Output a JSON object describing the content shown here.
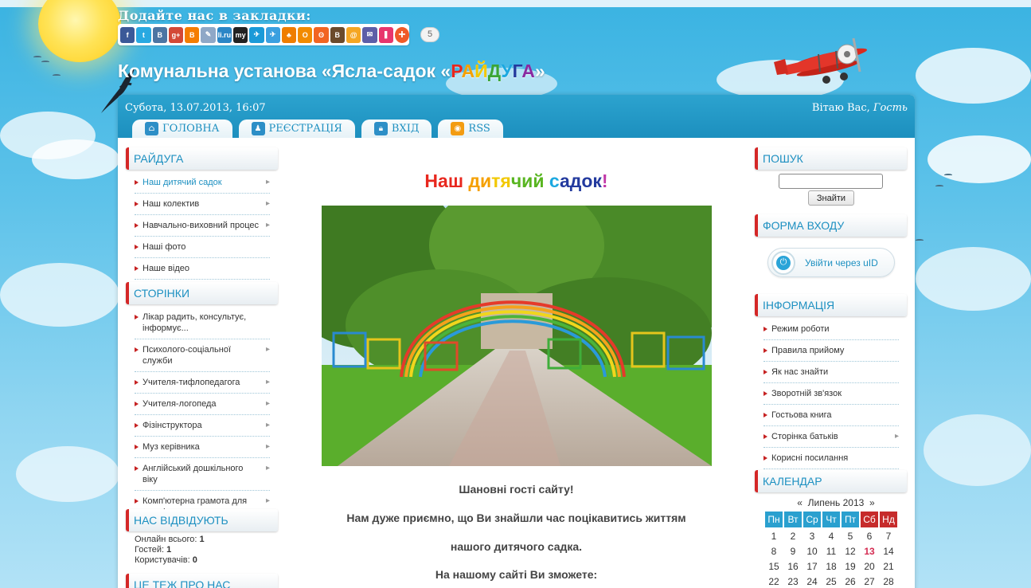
{
  "header": {
    "bookmark_title": "Додайте нас в закладки:",
    "share_count": "5",
    "site_title_prefix": "Комунальна установа «Ясла-садок «",
    "site_title_rainbow": [
      "Р",
      "А",
      "Й",
      "Д",
      "У",
      "Г",
      "А"
    ],
    "site_title_suffix": "»"
  },
  "share_buttons": [
    {
      "name": "facebook",
      "glyph": "f",
      "color": "#3b5998"
    },
    {
      "name": "twitter",
      "glyph": "t",
      "color": "#29a9e1"
    },
    {
      "name": "vkontakte",
      "glyph": "B",
      "color": "#4c75a3"
    },
    {
      "name": "google-plus",
      "glyph": "g+",
      "color": "#d34836"
    },
    {
      "name": "blogger",
      "glyph": "B",
      "color": "#f57d00"
    },
    {
      "name": "livejournal",
      "glyph": "✎",
      "color": "#8fa8c7"
    },
    {
      "name": "liveinternet",
      "glyph": "li.ru",
      "color": "#2b86c6"
    },
    {
      "name": "myspace",
      "glyph": "my",
      "color": "#222222"
    },
    {
      "name": "mailru-bird",
      "glyph": "✈",
      "color": "#1a9ad8"
    },
    {
      "name": "surfingbird",
      "glyph": "✈",
      "color": "#3aa0e0"
    },
    {
      "name": "odnoklassniki-run",
      "glyph": "♣",
      "color": "#ef7d00"
    },
    {
      "name": "odnoklassniki",
      "glyph": "О",
      "color": "#f28b00"
    },
    {
      "name": "rutvit",
      "glyph": "ʘ",
      "color": "#f26522"
    },
    {
      "name": "bobrdobr",
      "glyph": "B",
      "color": "#6b4a2b"
    },
    {
      "name": "mail-at",
      "glyph": "@",
      "color": "#f5a623"
    },
    {
      "name": "email",
      "glyph": "✉",
      "color": "#5d5ea8"
    },
    {
      "name": "bookmarks",
      "glyph": "❚",
      "color": "#e8356d"
    }
  ],
  "topbar": {
    "date": "Субота, 13.07.2013, 16:07",
    "greeting": "Вітаю Вас,",
    "guest": "Гость"
  },
  "tabs": [
    {
      "label": "ГОЛОВНА",
      "icon": "home-icon",
      "glyph": "⌂"
    },
    {
      "label": "РЕЄСТРАЦІЯ",
      "icon": "user-icon",
      "glyph": "♟"
    },
    {
      "label": "ВХІД",
      "icon": "lock-icon",
      "glyph": "🔒︎"
    },
    {
      "label": "RSS",
      "icon": "rss-icon",
      "glyph": "◉"
    }
  ],
  "left": {
    "raiduga": {
      "title": "Райдуга",
      "items": [
        {
          "label": "Наш дитячий садок",
          "active": true
        },
        {
          "label": "Наш колектив"
        },
        {
          "label": "Навчально-виховний процес"
        },
        {
          "label": "Наші фото",
          "noarrow": true
        },
        {
          "label": "Наше відео",
          "noarrow": true
        }
      ]
    },
    "pages": {
      "title": "Сторінки",
      "items": [
        {
          "label": "Лікар радить, консультує, інформує...",
          "noarrow": true
        },
        {
          "label": "Психолого-соціальної служби"
        },
        {
          "label": "Учителя-тифлопедагога"
        },
        {
          "label": "Учителя-логопеда"
        },
        {
          "label": "Фізінструктора"
        },
        {
          "label": "Муз керівника"
        },
        {
          "label": "Англійський дошкільного віку"
        },
        {
          "label": "Комп'ютерна грамота для дошкілят"
        }
      ]
    },
    "visitors": {
      "title": "Нас відвідують",
      "online_label": "Онлайн всього:",
      "online": "1",
      "guests_label": "Гостей:",
      "guests": "1",
      "users_label": "Користувачів:",
      "users": "0"
    },
    "also": {
      "title": "Це теж про нас"
    }
  },
  "main": {
    "title_letters": [
      {
        "t": "Наш ",
        "c": "#e8271e"
      },
      {
        "t": "ди",
        "c": "#f5a000"
      },
      {
        "t": "тя",
        "c": "#f2c800"
      },
      {
        "t": "чий ",
        "c": "#58b520"
      },
      {
        "t": "с",
        "c": "#1ba8e0"
      },
      {
        "t": "адок",
        "c": "#233a9e"
      },
      {
        "t": "!",
        "c": "#c23aa8"
      }
    ],
    "p1": "Шановні гості сайту!",
    "p2": "Нам дуже приємно, що Ви знайшли час поцікавитись життям",
    "p3": "нашого дитячого садка.",
    "p4": "На нашому сайті Ви зможете:"
  },
  "right": {
    "search": {
      "title": "Пошук",
      "button": "Знайти",
      "value": ""
    },
    "login": {
      "title": "Форма входу",
      "uid_label": "Увійти через uID"
    },
    "info": {
      "title": "Інформація",
      "items": [
        {
          "label": "Режим роботи"
        },
        {
          "label": "Правила прийому"
        },
        {
          "label": "Як нас знайти"
        },
        {
          "label": "Зворотній зв'язок"
        },
        {
          "label": "Гостьова книга"
        },
        {
          "label": "Сторінка батьків",
          "arrow": true
        },
        {
          "label": "Корисні посилання"
        }
      ]
    },
    "calendar": {
      "title": "Календар",
      "prev": "«",
      "next": "»",
      "month": "Липень 2013",
      "days": [
        "Пн",
        "Вт",
        "Ср",
        "Чт",
        "Пт",
        "Сб",
        "Нд"
      ],
      "weeks": [
        [
          "1",
          "2",
          "3",
          "4",
          "5",
          "6",
          "7"
        ],
        [
          "8",
          "9",
          "10",
          "11",
          "12",
          "13",
          "14"
        ],
        [
          "15",
          "16",
          "17",
          "18",
          "19",
          "20",
          "21"
        ],
        [
          "22",
          "23",
          "24",
          "25",
          "26",
          "27",
          "28"
        ]
      ],
      "today": "13"
    }
  }
}
